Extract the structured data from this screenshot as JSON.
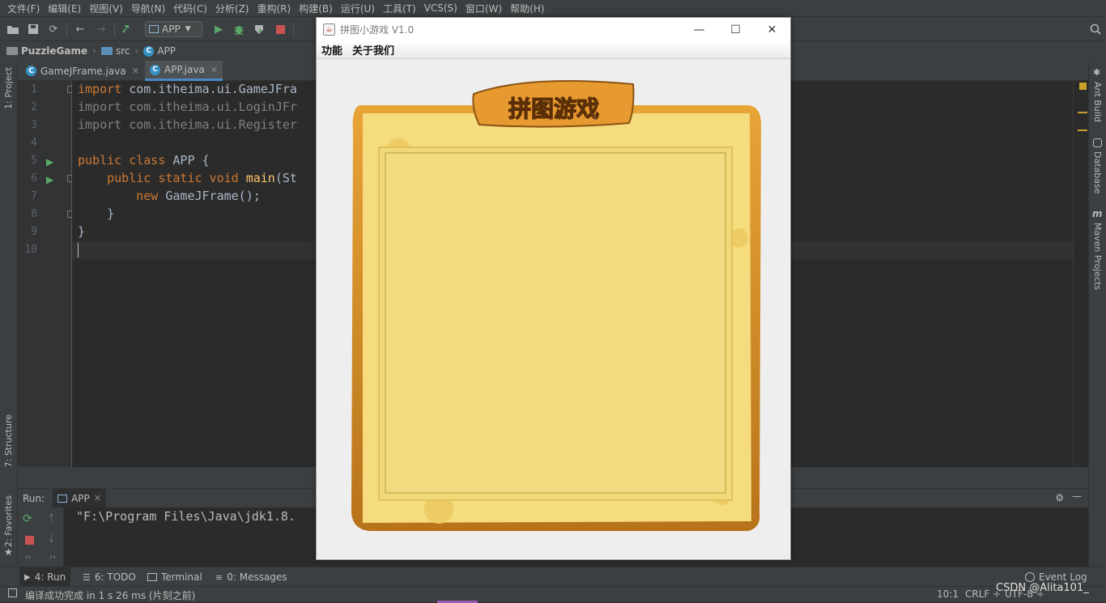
{
  "menu": [
    "文件(F)",
    "编辑(E)",
    "视图(V)",
    "导航(N)",
    "代码(C)",
    "分析(Z)",
    "重构(R)",
    "构建(B)",
    "运行(U)",
    "工具(T)",
    "VCS(S)",
    "窗口(W)",
    "帮助(H)"
  ],
  "toolbar": {
    "run_config": "APP"
  },
  "breadcrumb": {
    "project": "PuzzleGame",
    "folder": "src",
    "file": "APP"
  },
  "tabs": [
    {
      "label": "GameJFrame.java"
    },
    {
      "label": "APP.java"
    }
  ],
  "editor": {
    "line_numbers": [
      "1",
      "2",
      "3",
      "4",
      "5",
      "6",
      "7",
      "8",
      "9",
      "10"
    ],
    "lines": {
      "l1_kw": "import",
      "l1_rest": " com.itheima.ui.GameJFra",
      "l2": "import com.itheima.ui.LoginJFr",
      "l3": "import com.itheima.ui.Register",
      "l5_kw": "public class",
      "l5_rest": " APP {",
      "l6_kw": "    public static void",
      "l6_fn": " main",
      "l6_rest": "(St",
      "l7_kw": "        new",
      "l7_rest": " GameJFrame();",
      "l8": "    }",
      "l9": "}"
    }
  },
  "left_strip": {
    "project": "1: Project",
    "structure": "7: Structure",
    "favorites": "2: Favorites"
  },
  "right_strip": {
    "ant": "Ant Build",
    "database": "Database",
    "maven": "Maven Projects"
  },
  "run_panel": {
    "label": "Run:",
    "tab": "APP",
    "console": "\"F:\\Program Files\\Java\\jdk1.8."
  },
  "bottom_tabs": {
    "run": "4: Run",
    "todo": "6: TODO",
    "terminal": "Terminal",
    "messages": "0: Messages",
    "event_log": "Event Log"
  },
  "status": {
    "message": "编译成功完成 in 1 s 26 ms (片刻之前)",
    "position": "10:1",
    "line_sep": "CRLF ÷",
    "encoding": "UTF-8 ÷",
    "watermark": "CSDN @Alita101_"
  },
  "game": {
    "title": "拼图小游戏 V1.0",
    "menu": [
      "功能",
      "关于我们"
    ],
    "logo_text": "拼图游戏"
  }
}
